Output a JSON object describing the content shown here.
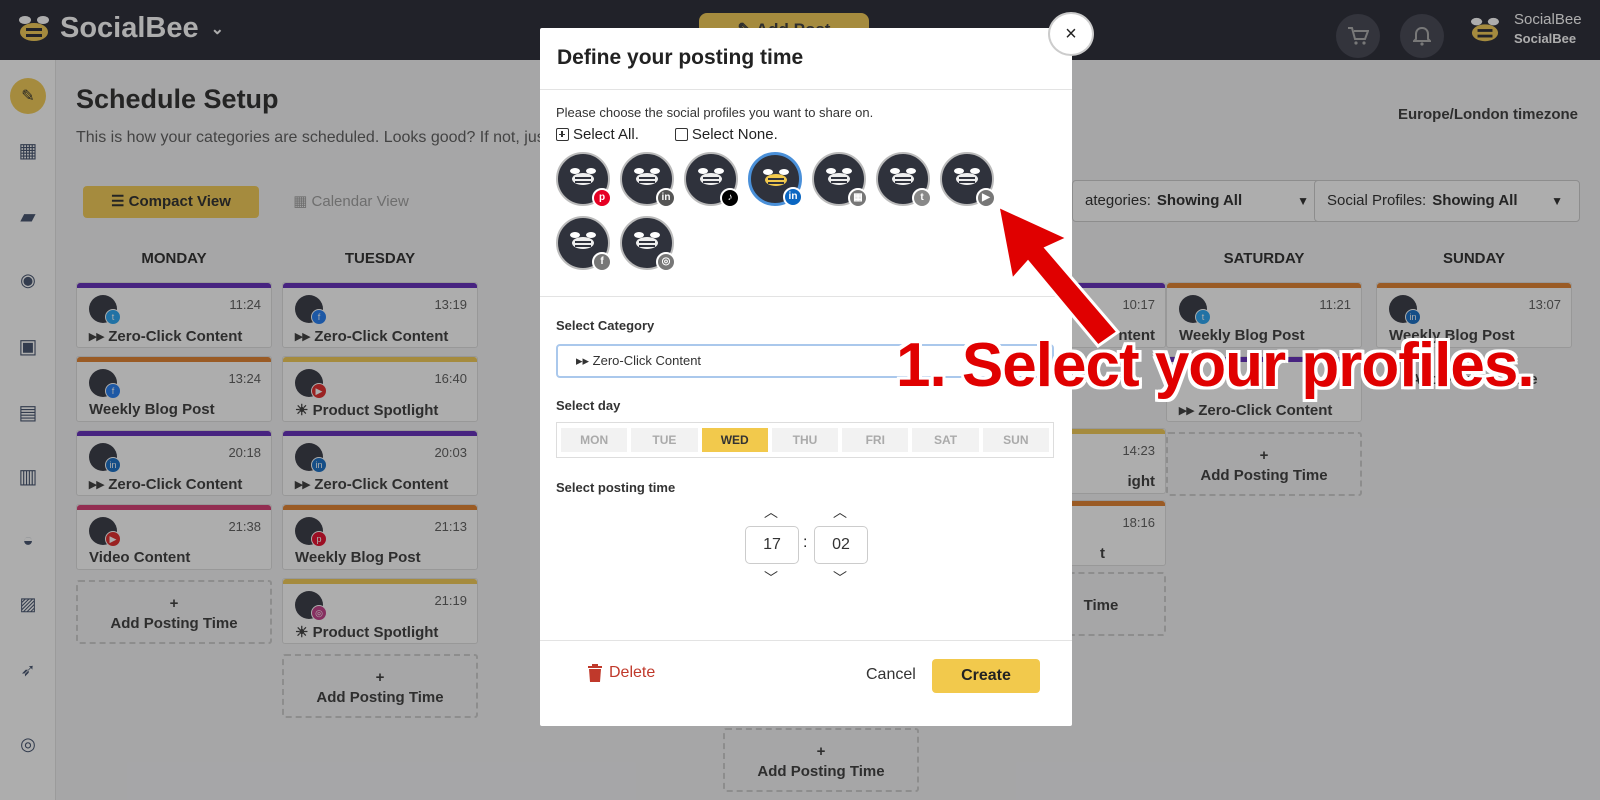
{
  "app": {
    "name": "SocialBee",
    "add_post": "Add Post",
    "user_line1": "SocialBee",
    "user_line2": "SocialBee"
  },
  "page": {
    "title": "Schedule Setup",
    "subtitle": "This is how your categories are scheduled. Looks good? If not, just c",
    "timezone": "Europe/London timezone",
    "compact_view": "Compact View",
    "calendar_view": "Calendar View",
    "filter_categories_label": "ategories:",
    "filter_categories_value": "Showing All",
    "filter_profiles_label": "Social Profiles:",
    "filter_profiles_value": "Showing All",
    "add_posting_time": "Add Posting Time"
  },
  "days": [
    "MONDAY",
    "TUESDAY",
    "SATURDAY",
    "SUNDAY"
  ],
  "cards": {
    "mon": [
      {
        "time": "11:24",
        "title": "▸▸ Zero-Click Content",
        "color": "#5b21b6",
        "badge": "t",
        "badge_color": "#1da1f2"
      },
      {
        "time": "13:24",
        "title": "Weekly Blog Post",
        "color": "#e07b24",
        "badge": "f",
        "badge_color": "#1877f2"
      },
      {
        "time": "20:18",
        "title": "▸▸ Zero-Click Content",
        "color": "#5b21b6",
        "badge": "in",
        "badge_color": "#0a66c2"
      },
      {
        "time": "21:38",
        "title": "Video Content",
        "color": "#d6336c",
        "badge": "▶",
        "badge_color": "#e02020"
      }
    ],
    "tue": [
      {
        "time": "13:19",
        "title": "▸▸ Zero-Click Content",
        "color": "#5b21b6",
        "badge": "f",
        "badge_color": "#1877f2"
      },
      {
        "time": "16:40",
        "title": "☀ Product Spotlight",
        "color": "#f2c94c",
        "badge": "▶",
        "badge_color": "#e02020"
      },
      {
        "time": "20:03",
        "title": "▸▸ Zero-Click Content",
        "color": "#5b21b6",
        "badge": "in",
        "badge_color": "#0a66c2"
      },
      {
        "time": "21:13",
        "title": "Weekly Blog Post",
        "color": "#e07b24",
        "badge": "p",
        "badge_color": "#e60023"
      },
      {
        "time": "21:19",
        "title": "☀ Product Spotlight",
        "color": "#f2c94c",
        "badge": "◎",
        "badge_color": "#c13584"
      }
    ],
    "sat": [
      {
        "time": "11:21",
        "title": "Weekly Blog Post",
        "color": "#e07b24",
        "badge": "t",
        "badge_color": "#1da1f2"
      },
      {
        "time": "",
        "title": "▸▸ Zero-Click Content",
        "color": "#5b21b6",
        "badge": "",
        "badge_color": ""
      }
    ],
    "sun": [
      {
        "time": "13:07",
        "title": "Weekly Blog Post",
        "color": "#e07b24",
        "badge": "in",
        "badge_color": "#0a66c2"
      }
    ],
    "fri_partial": [
      {
        "time": "10:17",
        "title": "ntent"
      },
      {
        "time": "14:23",
        "title": "ight"
      },
      {
        "time": "18:16",
        "title": "t"
      }
    ],
    "fri_add": "Time"
  },
  "modal": {
    "title": "Define your posting time",
    "choose_text": "Please choose the social profiles you want to share on.",
    "select_all": "Select All.",
    "select_none": "Select None.",
    "profiles": [
      {
        "network": "pinterest",
        "badge": "p",
        "badge_color": "#e60023",
        "selected": false
      },
      {
        "network": "linkedin",
        "badge": "in",
        "badge_color": "#555",
        "selected": false
      },
      {
        "network": "tiktok",
        "badge": "♪",
        "badge_color": "#000",
        "selected": false
      },
      {
        "network": "linkedin",
        "badge": "in",
        "badge_color": "#0a66c2",
        "selected": true
      },
      {
        "network": "google-business",
        "badge": "▦",
        "badge_color": "#777",
        "selected": false
      },
      {
        "network": "twitter",
        "badge": "t",
        "badge_color": "#888",
        "selected": false
      },
      {
        "network": "youtube",
        "badge": "▶",
        "badge_color": "#777",
        "selected": false
      },
      {
        "network": "facebook",
        "badge": "f",
        "badge_color": "#777",
        "selected": false
      },
      {
        "network": "instagram",
        "badge": "◎",
        "badge_color": "#777",
        "selected": false
      }
    ],
    "category_label": "Select Category",
    "category_value": "▸▸ Zero-Click Content",
    "day_label": "Select day",
    "days": [
      "MON",
      "TUE",
      "WED",
      "THU",
      "FRI",
      "SAT",
      "SUN"
    ],
    "selected_day": "WED",
    "time_label": "Select posting time",
    "hour": "17",
    "minute": "02",
    "colon": ":",
    "delete": "Delete",
    "cancel": "Cancel",
    "create": "Create",
    "close": "×"
  },
  "annotation": "1. Select your profiles.",
  "colors": {
    "accent": "#f2c94c",
    "topbar": "#1e1f2b",
    "annotation": "#e00000"
  }
}
